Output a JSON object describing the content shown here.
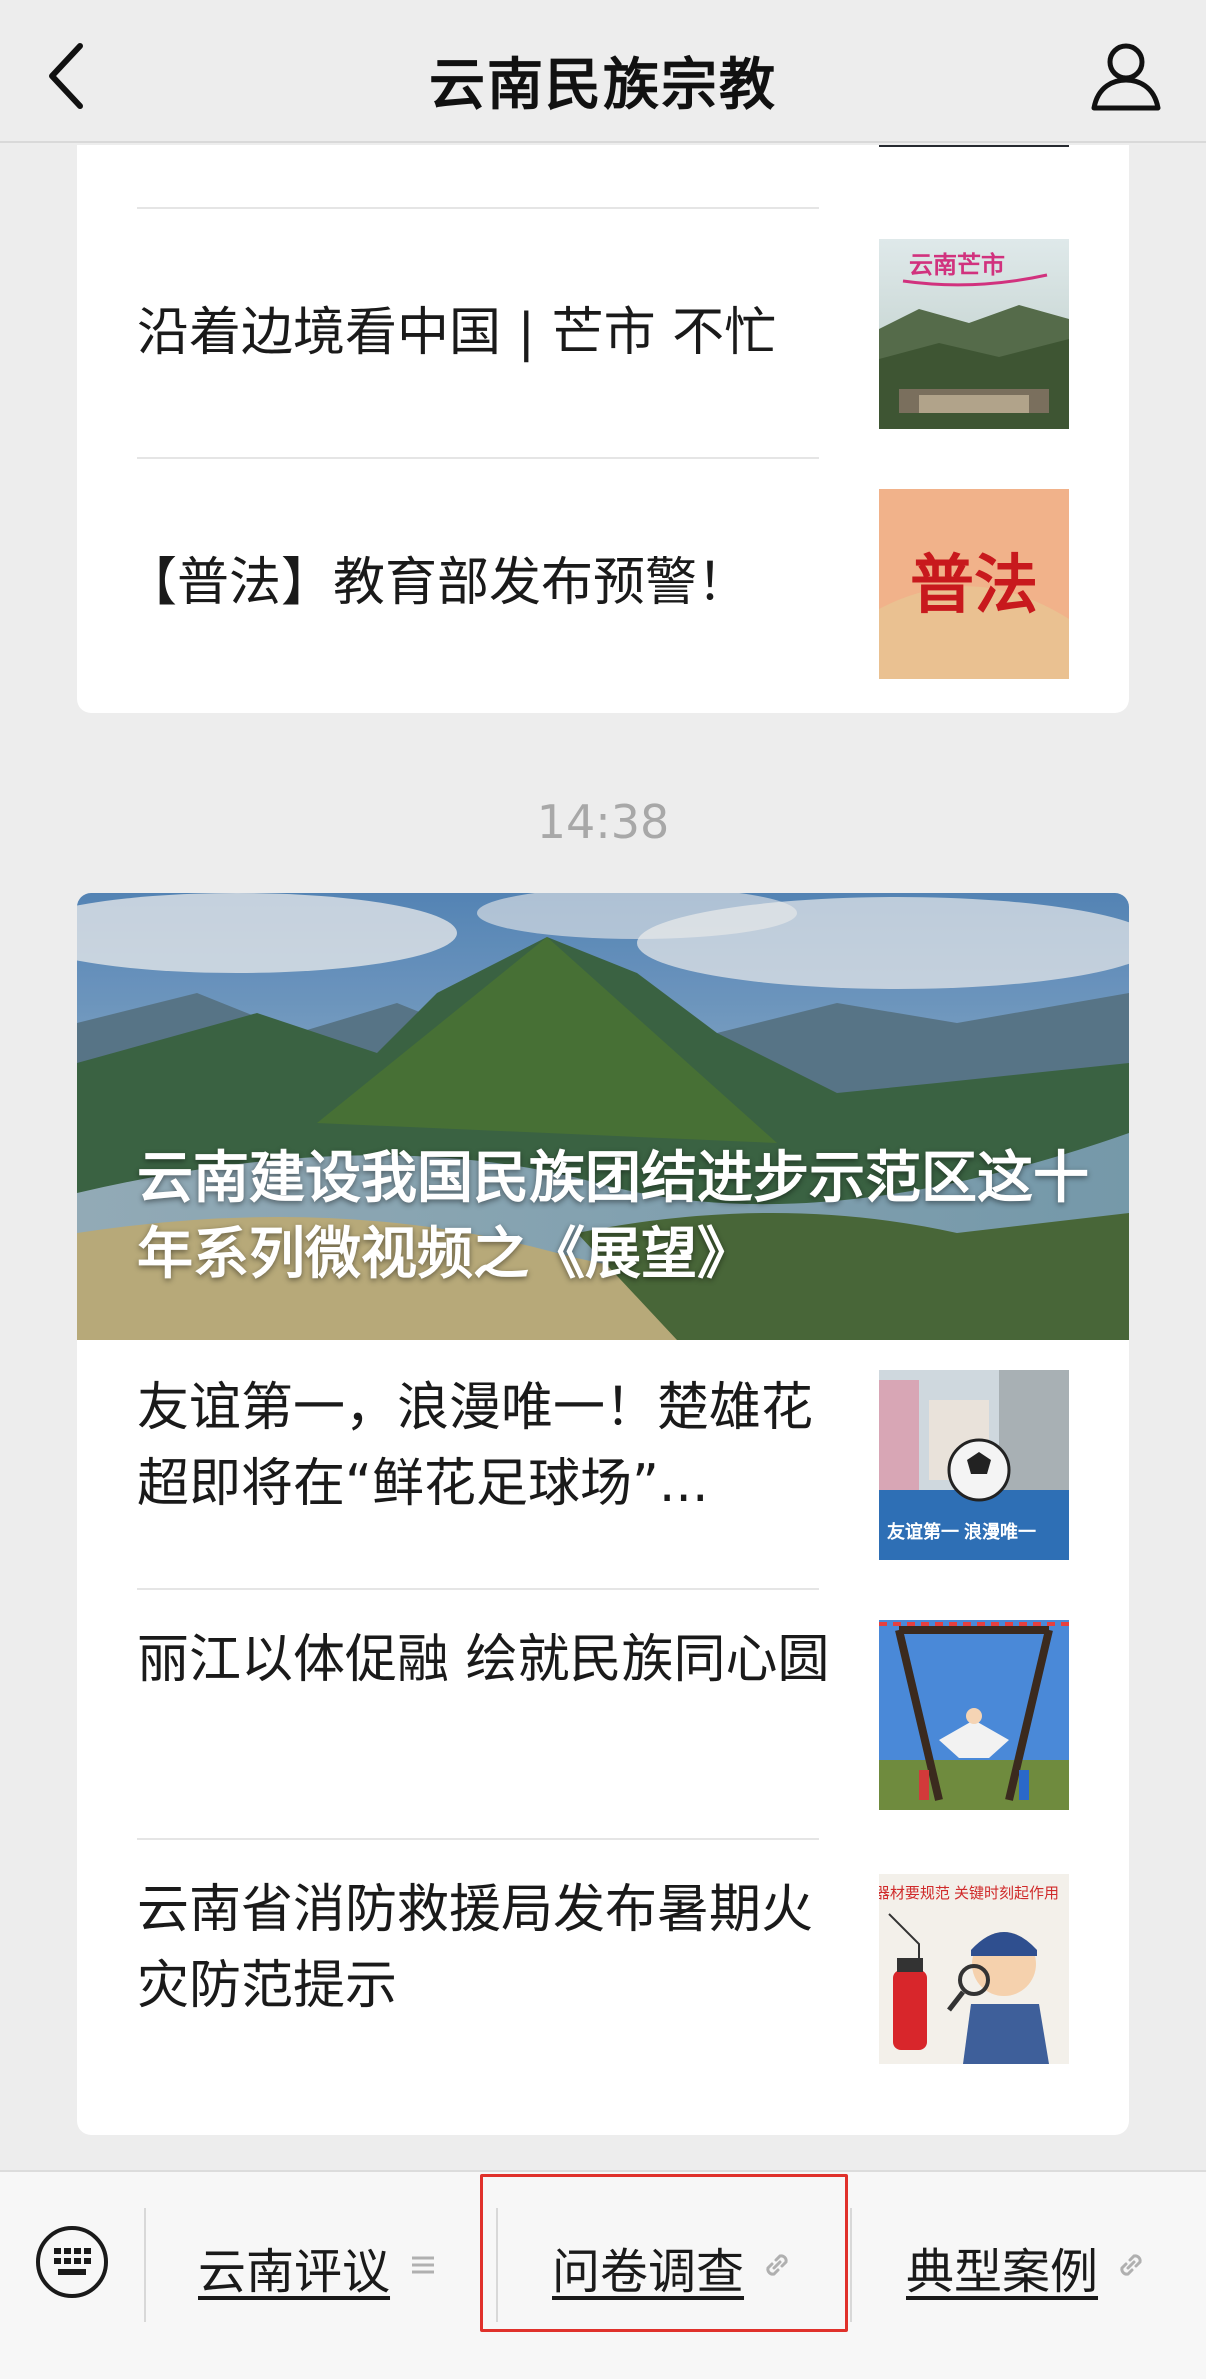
{
  "header": {
    "title": "云南民族宗教",
    "back_icon": "back-arrow-icon",
    "profile_icon": "profile-icon"
  },
  "group1": {
    "articles": [
      {
        "title": "沿着边境看中国 | 芒市 不忙",
        "thumb_text": "云南芒市"
      },
      {
        "title": "【普法】教育部发布预警！",
        "thumb_text": "普法"
      }
    ]
  },
  "timestamp": "14:38",
  "group2": {
    "hero_title": "云南建设我国民族团结进步示范区这十年系列微视频之《展望》",
    "articles": [
      {
        "title": "友谊第一，浪漫唯一！楚雄花超即将在“鲜花足球场”...",
        "thumb_text": "友谊第一 浪漫唯一"
      },
      {
        "title": "丽江以体促融 绘就民族同心圆"
      },
      {
        "title": "云南省消防救援局发布暑期火灾防范提示",
        "thumb_text": "消防器材要规范 关键时刻起作用"
      }
    ]
  },
  "menu": {
    "keyboard_icon": "keyboard-icon",
    "items": [
      {
        "label": "云南评议",
        "icon": "menu-list-icon"
      },
      {
        "label": "问卷调查",
        "icon": "link-icon"
      },
      {
        "label": "典型案例",
        "icon": "link-icon"
      }
    ]
  },
  "colors": {
    "page_bg": "#ededed",
    "card_bg": "#ffffff",
    "timestamp": "#a8a8a8",
    "highlight": "#e0312b"
  }
}
